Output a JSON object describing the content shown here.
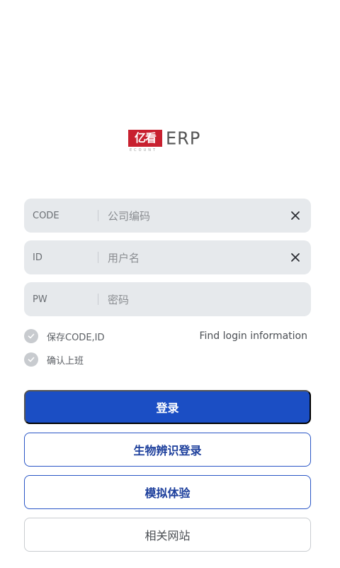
{
  "logo": {
    "mark_text": "亿看",
    "sub_text": "ECOUNT",
    "product_text": "ERP"
  },
  "fields": [
    {
      "label": "CODE",
      "placeholder": "公司编码",
      "has_clear": true
    },
    {
      "label": "ID",
      "placeholder": "用户名",
      "has_clear": true
    },
    {
      "label": "PW",
      "placeholder": "密码",
      "has_clear": false
    }
  ],
  "options": {
    "save_code_id": "保存CODE,ID",
    "confirm_work": "确认上班",
    "find_login": "Find login information"
  },
  "buttons": {
    "login": "登录",
    "biometric": "生物辨识登录",
    "demo": "模拟体验",
    "related_sites": "相关网站"
  },
  "colors": {
    "brand_red": "#c8202f",
    "primary_blue": "#1b4ec4",
    "field_bg": "#e6e9ec"
  }
}
